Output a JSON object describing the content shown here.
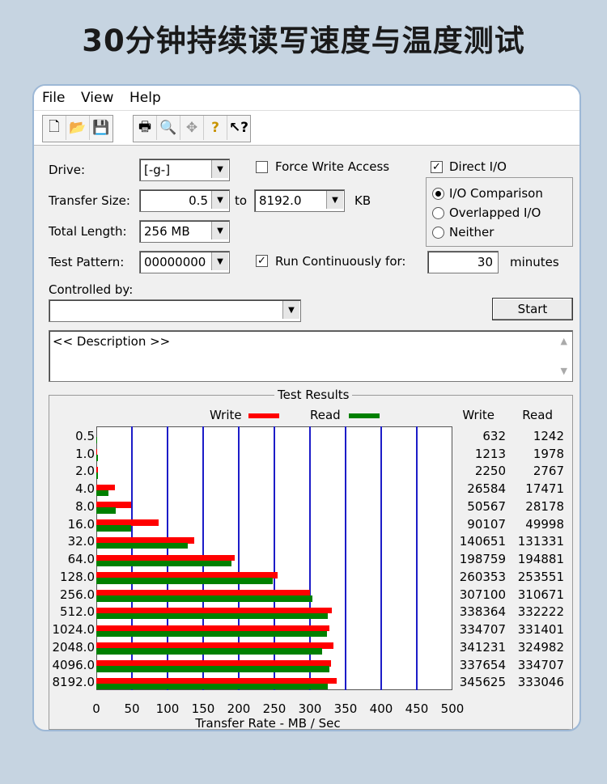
{
  "headline": "30分钟持续读写速度与温度测试",
  "menu": [
    "File",
    "View",
    "Help"
  ],
  "toolbar_icons": [
    "new-icon",
    "open-icon",
    "save-icon",
    "print-icon",
    "print-preview-icon",
    "move-icon",
    "help-icon",
    "context-help-icon"
  ],
  "form": {
    "drive_label": "Drive:",
    "drive_value": "[-g-]",
    "transfer_size_label": "Transfer Size:",
    "transfer_from": "0.5",
    "to_label": "to",
    "transfer_to": "8192.0",
    "kb_label": "KB",
    "total_length_label": "Total Length:",
    "total_length_value": "256 MB",
    "test_pattern_label": "Test Pattern:",
    "test_pattern_value": "00000000",
    "controlled_by_label": "Controlled by:",
    "controlled_by_value": "",
    "force_write_label": "Force Write Access",
    "force_write_checked": false,
    "run_cont_label": "Run Continuously for:",
    "run_cont_checked": true,
    "direct_io_label": "Direct I/O",
    "direct_io_checked": true,
    "radio_options": [
      "I/O Comparison",
      "Overlapped I/O",
      "Neither"
    ],
    "radio_selected": 0,
    "minutes_value": "30",
    "minutes_label": "minutes",
    "start_label": "Start",
    "description": "<< Description >>"
  },
  "chart_data": {
    "type": "bar",
    "title": "Test Results",
    "xlabel": "Transfer Rate - MB / Sec",
    "xlim": [
      0,
      500
    ],
    "xticks": [
      0,
      50,
      100,
      150,
      200,
      250,
      300,
      350,
      400,
      450,
      500
    ],
    "categories": [
      "0.5",
      "1.0",
      "2.0",
      "4.0",
      "8.0",
      "16.0",
      "32.0",
      "64.0",
      "128.0",
      "256.0",
      "512.0",
      "1024.0",
      "2048.0",
      "4096.0",
      "8192.0"
    ],
    "series": [
      {
        "name": "Write",
        "color": "#ff0000",
        "values": [
          0.62,
          1.18,
          2.2,
          25.96,
          49.38,
          87.99,
          137.35,
          194.1,
          254.25,
          299.9,
          330.43,
          326.86,
          333.23,
          329.79,
          337.52
        ]
      },
      {
        "name": "Read",
        "color": "#008000",
        "values": [
          1.21,
          1.93,
          2.7,
          17.06,
          27.52,
          48.83,
          128.25,
          190.31,
          247.61,
          303.39,
          324.44,
          323.63,
          317.37,
          326.86,
          325.24
        ]
      }
    ],
    "table_headers": [
      "Write",
      "Read"
    ],
    "write_kbps": [
      "632",
      "1213",
      "2250",
      "26584",
      "50567",
      "90107",
      "140651",
      "198759",
      "260353",
      "307100",
      "338364",
      "334707",
      "341231",
      "337654",
      "345625"
    ],
    "read_kbps": [
      "1242",
      "1978",
      "2767",
      "17471",
      "28178",
      "49998",
      "131331",
      "194881",
      "253551",
      "310671",
      "332222",
      "331401",
      "324982",
      "334707",
      "333046"
    ]
  }
}
